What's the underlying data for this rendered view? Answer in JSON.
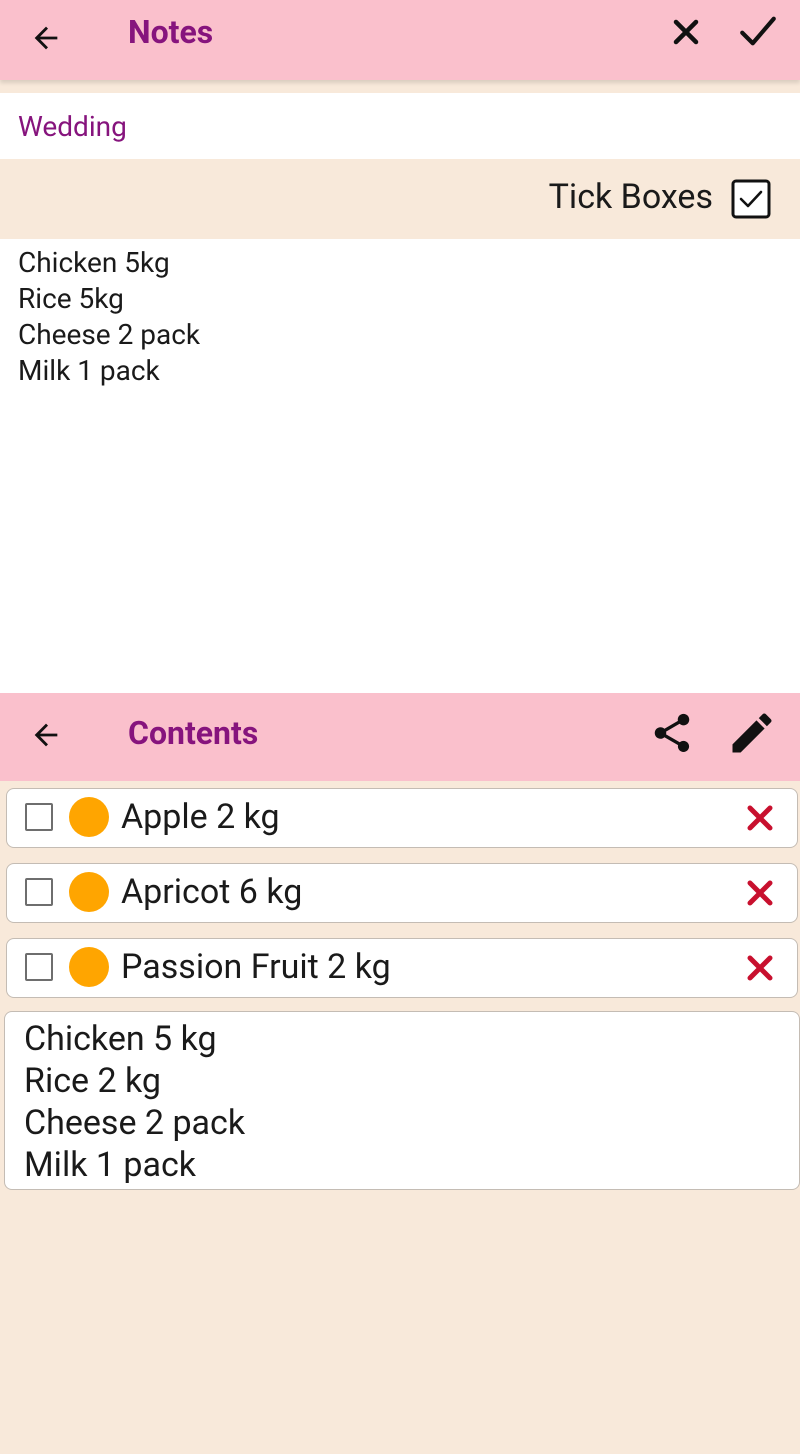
{
  "top_bar": {
    "title": "Notes",
    "back_icon": "arrow-left-icon",
    "cancel_icon": "close-icon",
    "confirm_icon": "check-icon"
  },
  "note": {
    "title_value": "Wedding",
    "tick_boxes_label": "Tick Boxes",
    "tick_boxes_checked": true,
    "body_lines": [
      "Chicken 5kg",
      "Rice 5kg",
      "Cheese 2 pack",
      "Milk 1 pack"
    ]
  },
  "contents_bar": {
    "title": "Contents",
    "back_icon": "arrow-left-icon",
    "share_icon": "share-icon",
    "edit_icon": "pencil-icon"
  },
  "items": [
    {
      "text": "Apple 2 kg",
      "checked": false,
      "dot_color": "#ffa500"
    },
    {
      "text": "Apricot 6 kg",
      "checked": false,
      "dot_color": "#ffa500"
    },
    {
      "text": "Passion Fruit 2 kg",
      "checked": false,
      "dot_color": "#ffa500"
    }
  ],
  "contents_text_lines": [
    "Chicken 5 kg",
    "Rice 2 kg",
    "Cheese 2 pack",
    "Milk 1 pack"
  ],
  "colors": {
    "app_bar": "#fac0cc",
    "title_purple": "#86147d",
    "background": "#f8e9da",
    "delete_red": "#c8102e",
    "dot_orange": "#ffa500"
  }
}
